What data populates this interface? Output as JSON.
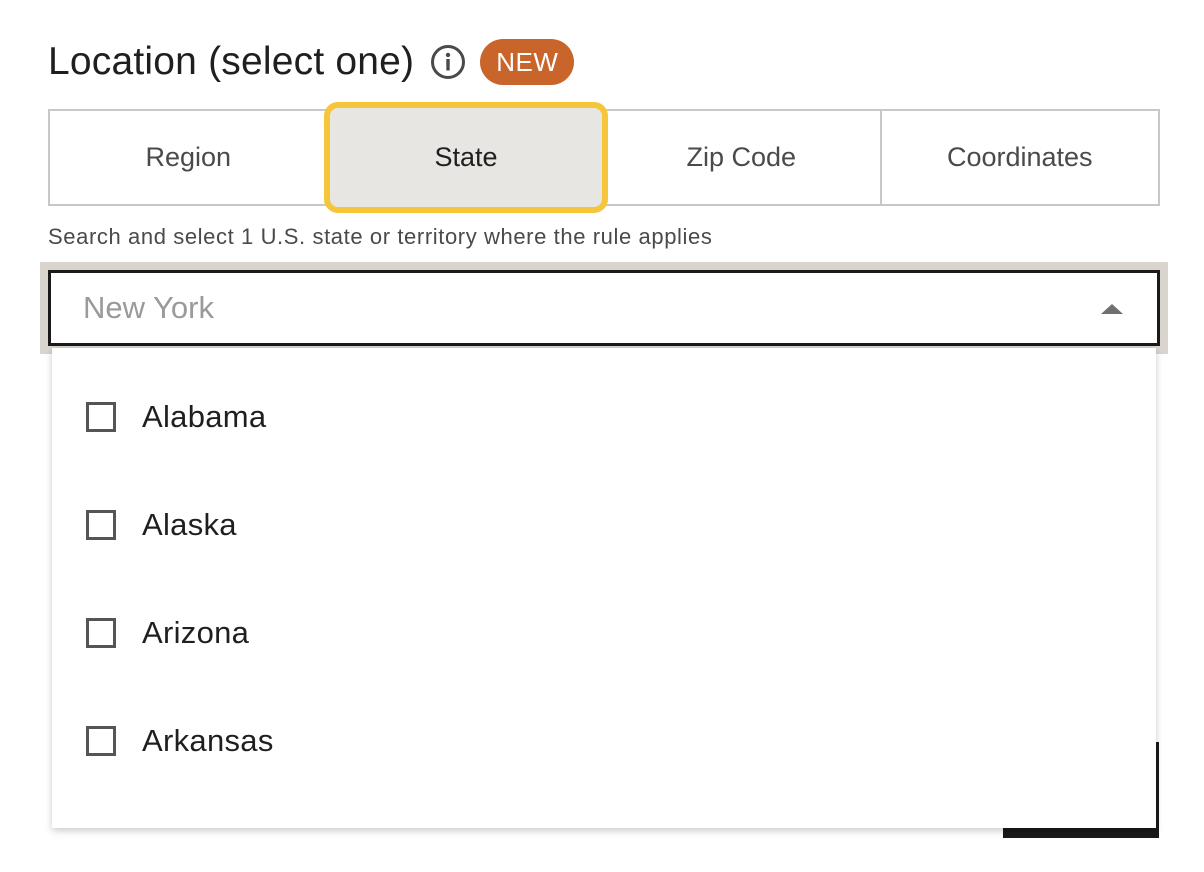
{
  "header": {
    "title": "Location (select one)",
    "badge": "NEW",
    "badge_color": "#c9652b"
  },
  "tabs": [
    {
      "label": "Region",
      "selected": false
    },
    {
      "label": "State",
      "selected": true
    },
    {
      "label": "Zip Code",
      "selected": false
    },
    {
      "label": "Coordinates",
      "selected": false
    }
  ],
  "helper_text": "Search and select 1 U.S. state or territory where the rule applies",
  "search": {
    "placeholder": "New York",
    "value": ""
  },
  "options": [
    {
      "label": "Alabama",
      "checked": false
    },
    {
      "label": "Alaska",
      "checked": false
    },
    {
      "label": "Arizona",
      "checked": false
    },
    {
      "label": "Arkansas",
      "checked": false
    }
  ],
  "colors": {
    "focus_ring": "#f5c53b",
    "active_tab_bg": "#e8e6e2"
  }
}
